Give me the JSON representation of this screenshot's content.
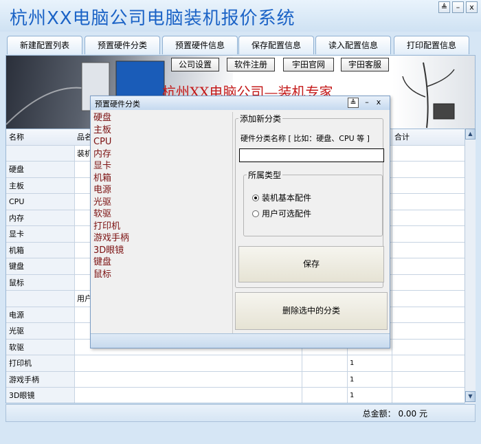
{
  "window": {
    "title": "杭州XX电脑公司电脑装机报价系统",
    "controls": {
      "restore": "≜",
      "minimize": "–",
      "close": "x"
    }
  },
  "tabs": [
    "新建配置列表",
    "预置硬件分类",
    "预置硬件信息",
    "保存配置信息",
    "读入配置信息",
    "打印配置信息"
  ],
  "banner": {
    "buttons": [
      "公司设置",
      "软件注册",
      "宇田官网",
      "宇田客服"
    ],
    "slogan": "杭州XX电脑公司—装机专家"
  },
  "table": {
    "headers": {
      "name": "名称",
      "product": "品名",
      "total": "合计"
    },
    "group_basic": "装机",
    "group_optional": "用户",
    "rows": [
      "硬盘",
      "主板",
      "CPU",
      "内存",
      "显卡",
      "机箱",
      "键盘",
      "鼠标",
      "电源",
      "光驱",
      "软驱",
      "打印机",
      "游戏手柄",
      "3D眼镜"
    ],
    "qty_rows": [
      "1",
      "1",
      "1"
    ]
  },
  "status": {
    "total_label": "总金额：",
    "total_value": "0.00 元"
  },
  "dialog": {
    "title": "预置硬件分类",
    "categories": [
      "硬盘",
      "主板",
      "CPU",
      "内存",
      "显卡",
      "机箱",
      "电源",
      "光驱",
      "软驱",
      "打印机",
      "游戏手柄",
      "3D眼镜",
      "键盘",
      "鼠标"
    ],
    "add_group_label": "添加新分类",
    "category_name_label": "硬件分类名称 [ 比如：硬盘、CPU 等 ]",
    "category_name_value": "",
    "type_group_label": "所属类型",
    "type_options": [
      "装机基本配件",
      "用户可选配件"
    ],
    "selected_type": "装机基本配件",
    "save_button": "保存",
    "delete_button": "删除选中的分类"
  }
}
